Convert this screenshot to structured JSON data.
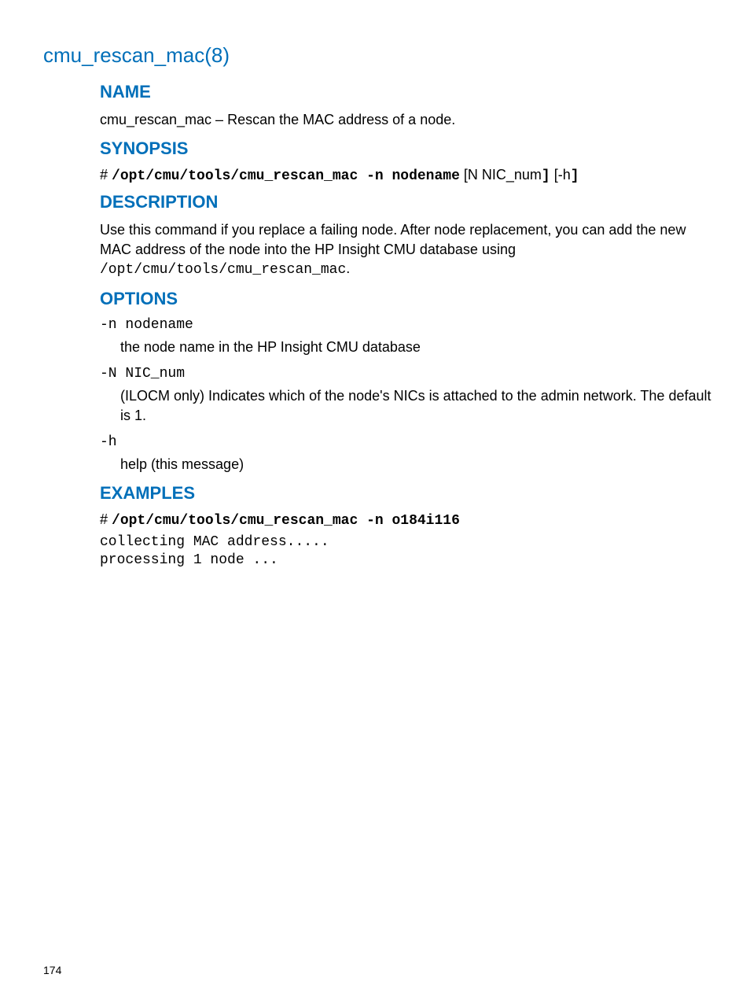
{
  "title": "cmu_rescan_mac(8)",
  "sections": {
    "name": {
      "heading": "NAME",
      "text": "cmu_rescan_mac – Rescan the MAC address of a node."
    },
    "synopsis": {
      "heading": "SYNOPSIS",
      "prompt": "# ",
      "cmd": "/opt/cmu/tools/cmu_rescan_mac -n nodename",
      "opt1": " [N NIC_num",
      "opt1b": "]",
      "opt2": " [-h",
      "opt2b": "]"
    },
    "description": {
      "heading": "DESCRIPTION",
      "pre": "Use this command if you replace a failing node. After node replacement, you can add the new MAC address of the node into the HP Insight CMU database using ",
      "code": "/opt/cmu/tools/cmu_rescan_mac",
      "post": "."
    },
    "options": {
      "heading": "OPTIONS",
      "items": [
        {
          "term": "-n nodename",
          "desc": "the node name in the HP Insight CMU database"
        },
        {
          "term": "-N NIC_num",
          "desc": "(ILOCM only) Indicates which of the node's NICs is attached to the admin network. The default is 1."
        },
        {
          "term": "-h",
          "desc": "help (this message)"
        }
      ]
    },
    "examples": {
      "heading": "EXAMPLES",
      "prompt": "# ",
      "cmd": "/opt/cmu/tools/cmu_rescan_mac -n o184i116",
      "output": "collecting MAC address.....\nprocessing 1 node ..."
    }
  },
  "pageNumber": "174"
}
